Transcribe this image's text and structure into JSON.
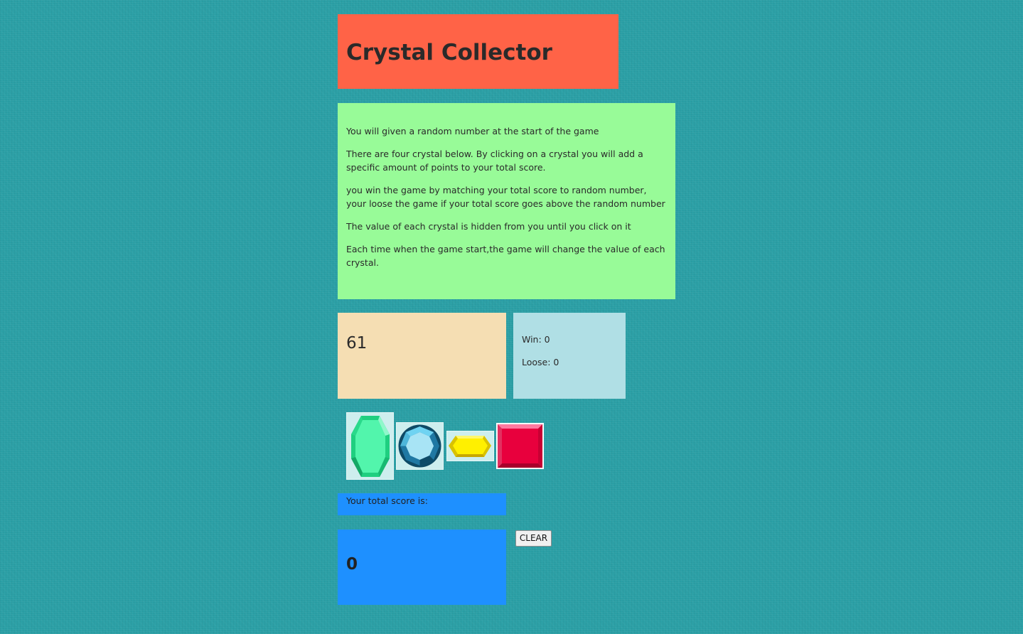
{
  "app": {
    "title": "Crystal Collector"
  },
  "instructions": [
    "You will given a random number at the start of the game",
    "There are four crystal below. By clicking on a crystal you will add a specific amount of points to your total score.",
    "you win the game by matching your total score to random number, your loose the game if your total score goes above the random number",
    "The value of each crystal is hidden from you until you click on it",
    "Each time when the game start,the game will change the value of each crystal."
  ],
  "target": {
    "random_number": "61"
  },
  "stats": {
    "wins_label": "Win: 0",
    "losses_label": "Loose: 0"
  },
  "crystals": [
    {
      "icon": "green-crystal-icon",
      "color": "#3ef0a0"
    },
    {
      "icon": "blue-crystal-icon",
      "color": "#5ec9e8"
    },
    {
      "icon": "yellow-crystal-icon",
      "color": "#ffe600"
    },
    {
      "icon": "red-crystal-icon",
      "color": "#e8003d"
    }
  ],
  "score": {
    "label": "Your total score is:",
    "value": "0"
  },
  "controls": {
    "clear_label": "CLEAR"
  },
  "colors": {
    "background": "#2a9fa5",
    "title_bg": "#ff6347",
    "instructions_bg": "#98fb98",
    "target_bg": "#f5deb3",
    "stats_bg": "#b0dfe5",
    "score_bg": "#1e90ff"
  }
}
